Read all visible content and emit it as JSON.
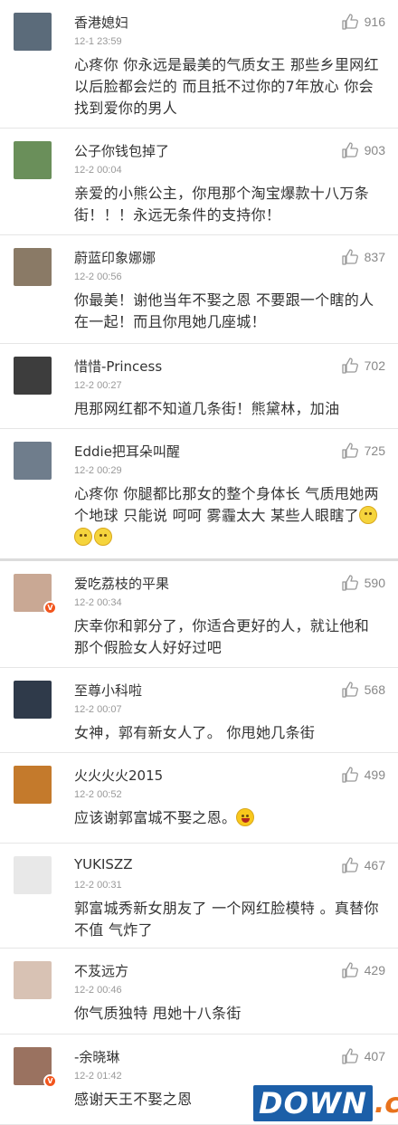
{
  "comments": [
    {
      "name": "香港媳妇",
      "time": "12-1 23:59",
      "likes": "916",
      "text": "心疼你 你永远是最美的气质女王 那些乡里网红以后脸都会烂的 而且抵不过你的7年放心 你会找到爱你的男人",
      "avatar_color": "#5b6b7a",
      "verified": false
    },
    {
      "name": "公子你钱包掉了",
      "time": "12-2 00:04",
      "likes": "903",
      "text": "亲爱的小熊公主，你甩那个淘宝爆款十八万条街！！！永远无条件的支持你！",
      "avatar_color": "#6a8f5a",
      "verified": false
    },
    {
      "name": "蔚蓝印象娜娜",
      "time": "12-2 00:56",
      "likes": "837",
      "text": "你最美！谢他当年不娶之恩 不要跟一个瞎的人在一起！而且你甩她几座城！",
      "avatar_color": "#8a7a66",
      "verified": false
    },
    {
      "name": "惜惜-Princess",
      "time": "12-2 00:27",
      "likes": "702",
      "text": "甩那网红都不知道几条街！熊黛林，加油",
      "avatar_color": "#3d3d3d",
      "verified": false
    },
    {
      "name": "Eddie把耳朵叫醒",
      "time": "12-2 00:29",
      "likes": "725",
      "text": "心疼你 你腿都比那女的整个身体长 气质甩她两个地球 只能说 呵呵 雾霾太大 某些人眼瞎了",
      "avatar_color": "#6f7d8c",
      "verified": false,
      "emoji": [
        "facepalm",
        "facepalm",
        "facepalm"
      ]
    },
    {
      "name": "爱吃荔枝的平果",
      "time": "12-2 00:34",
      "likes": "590",
      "text": "庆幸你和郭分了，你适合更好的人，就让他和那个假脸女人好好过吧",
      "avatar_color": "#c9a894",
      "verified": true
    },
    {
      "name": "至尊小科啦",
      "time": "12-2 00:07",
      "likes": "568",
      "text": "女神，郭有新女人了。 你甩她几条街",
      "avatar_color": "#2f3a4a",
      "verified": false
    },
    {
      "name": "火火火火2015",
      "time": "12-2 00:52",
      "likes": "499",
      "text": "应该谢郭富城不娶之恩。",
      "avatar_color": "#c47a2c",
      "verified": false,
      "emoji": [
        "laugh"
      ]
    },
    {
      "name": "YUKISZZ",
      "time": "12-2 00:31",
      "likes": "467",
      "text": "郭富城秀新女朋友了 一个网红脸模特 。真替你不值 气炸了",
      "avatar_color": "#e8e8e8",
      "verified": false
    },
    {
      "name": "不芨远方",
      "time": "12-2 00:46",
      "likes": "429",
      "text": "你气质独特 甩她十八条街",
      "avatar_color": "#d8c2b4",
      "verified": false
    },
    {
      "name": "-余晓琳",
      "time": "12-2 01:42",
      "likes": "407",
      "text": "感谢天王不娶之恩",
      "avatar_color": "#9a7260",
      "verified": true
    }
  ],
  "watermark": {
    "main": "DOWN",
    "suffix": ".cc"
  }
}
